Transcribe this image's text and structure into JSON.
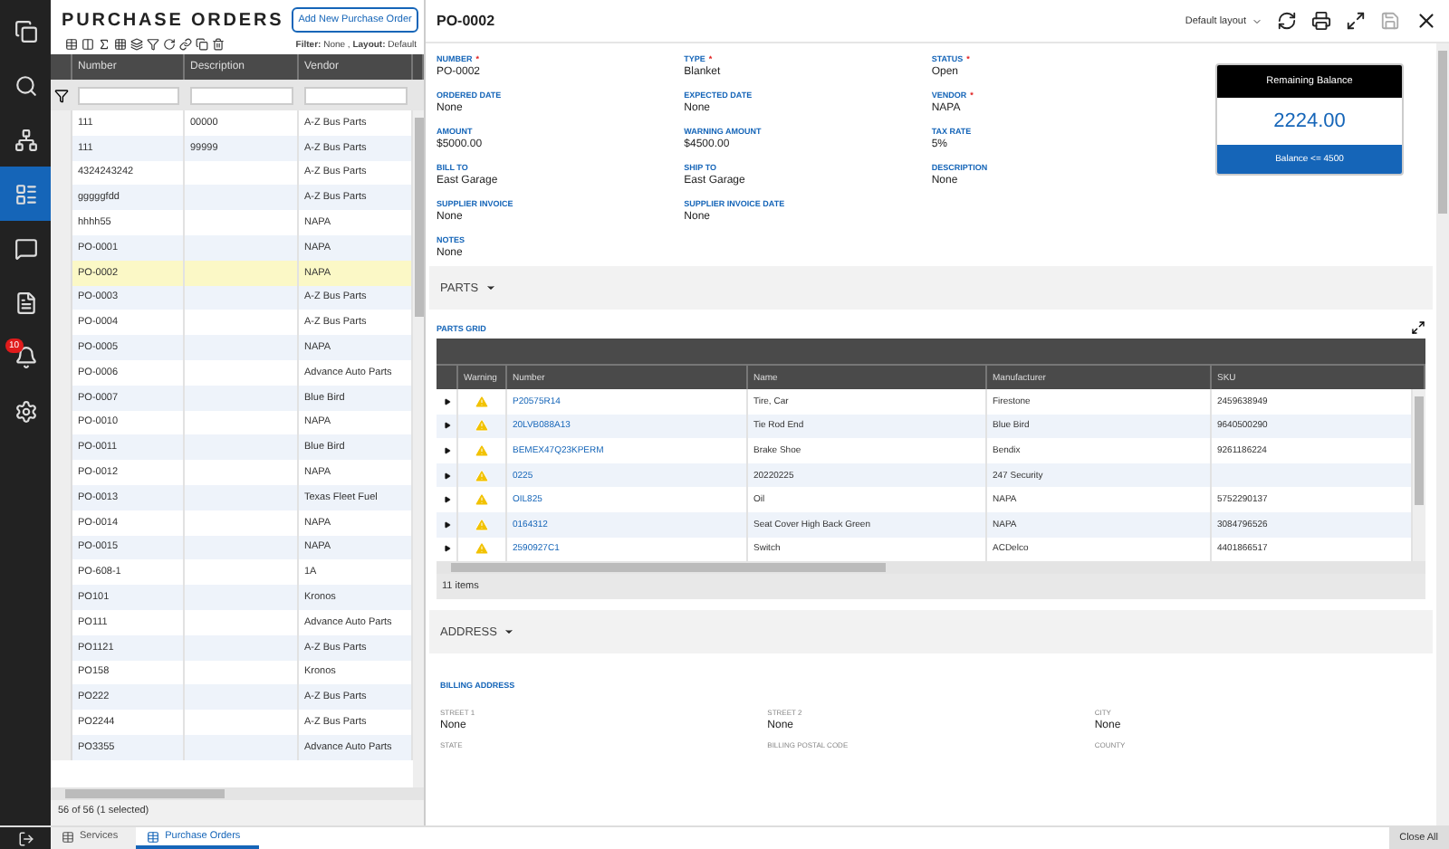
{
  "sidebar": {
    "items": [
      {
        "selected": false
      },
      {
        "selected": false
      },
      {
        "selected": false
      },
      {
        "selected": true
      },
      {
        "selected": false
      },
      {
        "selected": false
      },
      {
        "selected": false,
        "badge": "10"
      },
      {
        "selected": false
      }
    ]
  },
  "list_panel": {
    "title": "PURCHASE ORDERS",
    "add_button": "Add New Purchase Order",
    "filter_label": "Filter:",
    "filter_value": "None ,",
    "layout_label": "Layout:",
    "layout_value": "Default",
    "columns": [
      "Number",
      "Description",
      "Vendor"
    ],
    "rows": [
      {
        "number": "111",
        "description": "00000",
        "vendor": "A-Z Bus Parts",
        "selected": false
      },
      {
        "number": "111",
        "description": "99999",
        "vendor": "A-Z Bus Parts",
        "selected": false
      },
      {
        "number": "4324243242",
        "vendor": "A-Z Bus Parts",
        "selected": false
      },
      {
        "number": "gggggfdd",
        "vendor": "A-Z Bus Parts",
        "selected": false
      },
      {
        "number": "hhhh55",
        "vendor": "NAPA",
        "selected": false
      },
      {
        "number": "PO-0001",
        "vendor": "NAPA",
        "selected": false
      },
      {
        "number": "PO-0002",
        "vendor": "NAPA",
        "selected": true
      },
      {
        "number": "PO-0003",
        "vendor": "A-Z Bus Parts",
        "selected": false
      },
      {
        "number": "PO-0004",
        "vendor": "A-Z Bus Parts",
        "selected": false
      },
      {
        "number": "PO-0005",
        "vendor": "NAPA",
        "selected": false
      },
      {
        "number": "PO-0006",
        "vendor": "Advance Auto Parts",
        "selected": false
      },
      {
        "number": "PO-0007",
        "vendor": "Blue Bird",
        "selected": false
      },
      {
        "number": "PO-0010",
        "vendor": "NAPA",
        "selected": false
      },
      {
        "number": "PO-0011",
        "vendor": "Blue Bird",
        "selected": false
      },
      {
        "number": "PO-0012",
        "vendor": "NAPA",
        "selected": false
      },
      {
        "number": "PO-0013",
        "vendor": "Texas Fleet Fuel",
        "selected": false
      },
      {
        "number": "PO-0014",
        "vendor": "NAPA",
        "selected": false
      },
      {
        "number": "PO-0015",
        "vendor": "NAPA",
        "selected": false
      },
      {
        "number": "PO-608-1",
        "vendor": "1A",
        "selected": false
      },
      {
        "number": "PO101",
        "vendor": "Kronos",
        "selected": false
      },
      {
        "number": "PO111",
        "vendor": "Advance Auto Parts",
        "selected": false
      },
      {
        "number": "PO1121",
        "vendor": "A-Z Bus Parts",
        "selected": false
      },
      {
        "number": "PO158",
        "vendor": "Kronos",
        "selected": false
      },
      {
        "number": "PO222",
        "vendor": "A-Z Bus Parts",
        "selected": false
      },
      {
        "number": "PO2244",
        "vendor": "A-Z Bus Parts",
        "selected": false
      },
      {
        "number": "PO3355",
        "vendor": "Advance Auto Parts",
        "selected": false
      }
    ],
    "status": "56 of 56 (1 selected)"
  },
  "detail": {
    "title": "PO-0002",
    "layout_menu": "Default layout",
    "fields": [
      {
        "label": "NUMBER",
        "required_mark": "*",
        "value": "PO-0002"
      },
      {
        "label": "TYPE",
        "required_mark": "*",
        "value": "Blanket"
      },
      {
        "label": "STATUS",
        "required_mark": "*",
        "value": "Open"
      },
      {
        "label": "ORDERED DATE",
        "value": "None"
      },
      {
        "label": "EXPECTED DATE",
        "value": "None"
      },
      {
        "label": "VENDOR",
        "required_mark": "*",
        "value": "NAPA"
      },
      {
        "label": "AMOUNT",
        "value": "$5000.00"
      },
      {
        "label": "WARNING AMOUNT",
        "value": "$4500.00"
      },
      {
        "label": "TAX RATE",
        "value": "5%"
      },
      {
        "label": "BILL TO",
        "value": "East Garage"
      },
      {
        "label": "SHIP TO",
        "value": "East Garage"
      },
      {
        "label": "DESCRIPTION",
        "value": "None"
      },
      {
        "label": "SUPPLIER INVOICE",
        "value": "None"
      },
      {
        "label": "SUPPLIER INVOICE DATE",
        "value": "None"
      }
    ],
    "notes": {
      "label": "NOTES",
      "value": "None"
    },
    "balance_card": {
      "title": "Remaining Balance",
      "value": "2224.00",
      "footer": "Balance <= 4500"
    },
    "parts_section": {
      "title": "PARTS",
      "grid_label": "PARTS GRID",
      "columns": [
        "Warning",
        "Number",
        "Name",
        "Manufacturer",
        "SKU"
      ],
      "rows": [
        {
          "number": "P20575R14",
          "name": "Tire, Car",
          "manufacturer": "Firestone",
          "sku": "2459638949"
        },
        {
          "number": "20LVB088A13",
          "name": "Tie Rod End",
          "manufacturer": "Blue Bird",
          "sku": "9640500290"
        },
        {
          "number": "BEMEX47Q23KPERM",
          "name": "Brake Shoe",
          "manufacturer": "Bendix",
          "sku": "9261186224"
        },
        {
          "number": "0225",
          "name": "20220225",
          "manufacturer": "247 Security"
        },
        {
          "number": "OIL825",
          "name": "Oil",
          "manufacturer": "NAPA",
          "sku": "5752290137"
        },
        {
          "number": "0164312",
          "name": "Seat Cover High Back Green",
          "manufacturer": "NAPA",
          "sku": "3084796526"
        },
        {
          "number": "2590927C1",
          "name": "Switch",
          "manufacturer": "ACDelco",
          "sku": "4401866517"
        }
      ],
      "footer": "11 items"
    },
    "address_section": {
      "title": "ADDRESS",
      "group_label": "BILLING ADDRESS",
      "fields": [
        {
          "label": "STREET 1",
          "value": "None"
        },
        {
          "label": "STREET 2",
          "value": "None"
        },
        {
          "label": "CITY",
          "value": "None"
        },
        {
          "label": "STATE"
        },
        {
          "label": "BILLING POSTAL CODE"
        },
        {
          "label": "COUNTY"
        }
      ]
    }
  },
  "taskbar": {
    "tabs": [
      {
        "label": "Services",
        "selected": false
      },
      {
        "label": "Purchase Orders",
        "selected": true
      }
    ],
    "close_all": "Close All"
  }
}
